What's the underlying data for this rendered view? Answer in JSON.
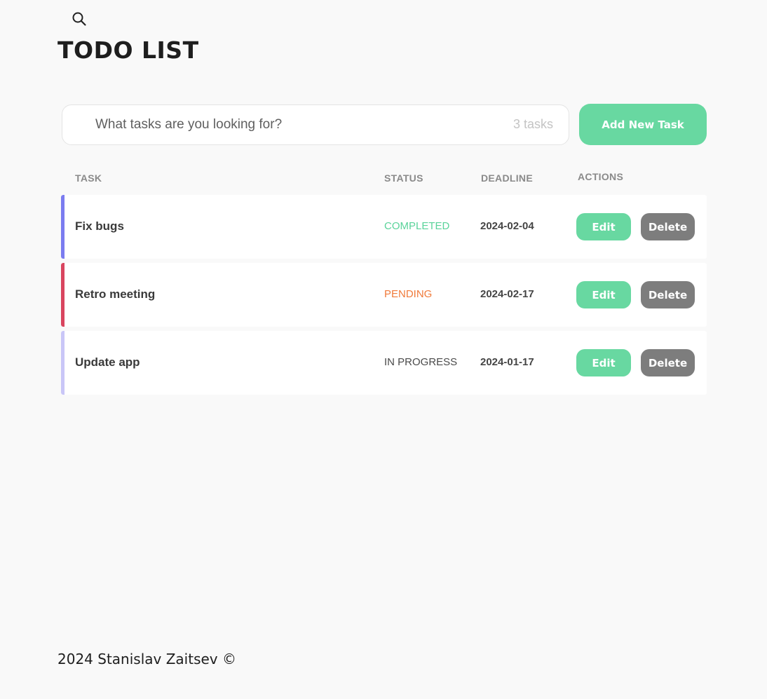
{
  "page": {
    "title": "TODO LIST"
  },
  "search": {
    "placeholder": "What tasks are you looking for?",
    "count_label": "3 tasks",
    "icon": "search-icon"
  },
  "toolbar": {
    "add_label": "Add New Task"
  },
  "table": {
    "columns": {
      "task": "TASK",
      "status": "STATUS",
      "deadline": "DEADLINE",
      "actions": "ACTIONS"
    },
    "rows": [
      {
        "name": "Fix bugs",
        "status": "COMPLETED",
        "deadline": "2024-02-04",
        "status_color": "#5ad39a",
        "accent": "#7b7cf0"
      },
      {
        "name": "Retro meeting",
        "status": "PENDING",
        "deadline": "2024-02-17",
        "status_color": "#f07a3a",
        "accent": "#d9455f"
      },
      {
        "name": "Update app",
        "status": "IN PROGRESS",
        "deadline": "2024-01-17",
        "status_color": "#4a4a4a",
        "accent": "#c9c6f7"
      }
    ],
    "edit_label": "Edit",
    "delete_label": "Delete"
  },
  "colors": {
    "accent": "#68d8a1",
    "delete": "#7d7d7d",
    "background": "#f9f9f9"
  },
  "footer": {
    "text": "2024 Stanislav Zaitsev ©"
  }
}
